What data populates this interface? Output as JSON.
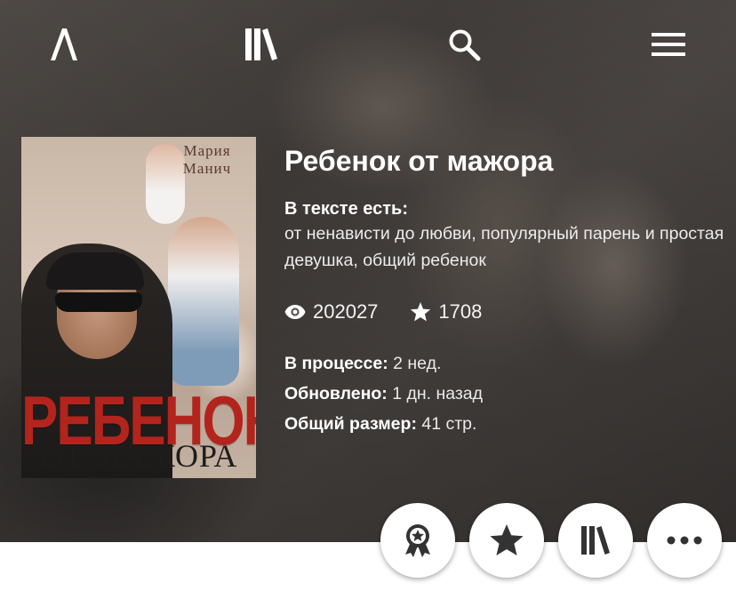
{
  "book": {
    "title": "Ребенок от мажора",
    "tags_label": "В тексте есть:",
    "tags_text": "от ненависти до любви, популярный парень и простая девушка, общий ребенок",
    "views": "202027",
    "rating": "1708",
    "in_progress_label": "В процессе:",
    "in_progress_value": "2 нед.",
    "updated_label": "Обновлено:",
    "updated_value": "1 дн. назад",
    "size_label": "Общий размер:",
    "size_value": "41 стр."
  },
  "cover": {
    "author": "Мария Манич",
    "title_line1": "РЕБЕНОК",
    "title_line2": "ОТ МАЖОРА"
  },
  "icons": {
    "logo": "logo-icon",
    "library": "library-icon",
    "search": "search-icon",
    "menu": "menu-icon",
    "views": "eye-icon",
    "rating": "star-icon",
    "award": "award-icon",
    "favorite": "star-icon",
    "add_library": "library-icon",
    "more": "more-icon"
  },
  "colors": {
    "accent_red": "#b3241d",
    "text": "#ffffff",
    "button_bg": "#ffffff"
  }
}
